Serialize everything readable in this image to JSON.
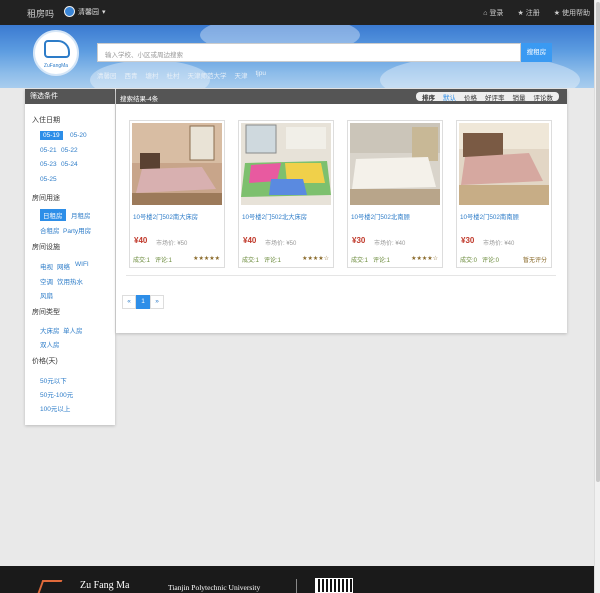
{
  "topnav": {
    "brand": "租房吗",
    "city": "清馨园",
    "login": "登录",
    "register": "注册",
    "help": "使用帮助"
  },
  "hero": {
    "logo_text": "ZuFangMa",
    "search_placeholder": "输入学校、小区或周边搜索",
    "search_button": "搜租房",
    "hot_places": [
      "清馨园",
      "西青",
      "塘村",
      "杜村",
      "天津师范大学",
      "天津",
      "tjpu"
    ]
  },
  "sidebar": {
    "title": "筛选条件",
    "date_title": "入住日期",
    "dates": [
      "05-19",
      "05-20",
      "05-21",
      "05-22",
      "05-23",
      "05-24",
      "05-25"
    ],
    "usage_title": "房间用途",
    "usages": [
      "日租房",
      "月租房",
      "合租房",
      "Party用房"
    ],
    "facilities_title": "房间设施",
    "facilities": [
      "电视",
      "网络",
      "WIFI",
      "空调",
      "饮用热水",
      "风扇"
    ],
    "type_title": "房间类型",
    "types": [
      "大床房",
      "单人房",
      "双人房"
    ],
    "price_title": "价格(天)",
    "prices": [
      "50元以下",
      "50元-100元",
      "100元以上"
    ]
  },
  "results": {
    "title": "搜索结果-4条",
    "sort_label": "排序",
    "sorts": [
      "默认",
      "价格",
      "好评率",
      "销量",
      "评论数"
    ],
    "listings": [
      {
        "name": "10号楼2门502南大床房",
        "price": "¥40",
        "market": "市场价: ¥50",
        "deals": "成交:1",
        "comments": "评论:1",
        "rating": "★★★★★"
      },
      {
        "name": "10号楼2门502北大床房",
        "price": "¥40",
        "market": "市场价: ¥50",
        "deals": "成交:1",
        "comments": "评论:1",
        "rating": "★★★★☆"
      },
      {
        "name": "10号楼2门502北南顾",
        "price": "¥30",
        "market": "市场价: ¥40",
        "deals": "成交:1",
        "comments": "评论:1",
        "rating": "★★★★☆"
      },
      {
        "name": "10号楼2门502南南顾",
        "price": "¥30",
        "market": "市场价: ¥40",
        "deals": "成交:0",
        "comments": "评论:0",
        "rating": "暂无评分"
      }
    ],
    "pager": {
      "prev": "«",
      "current": "1",
      "next": "»"
    }
  },
  "footer": {
    "brand": "Zu Fang Ma",
    "university": "Tianjin Polytechnic University"
  }
}
